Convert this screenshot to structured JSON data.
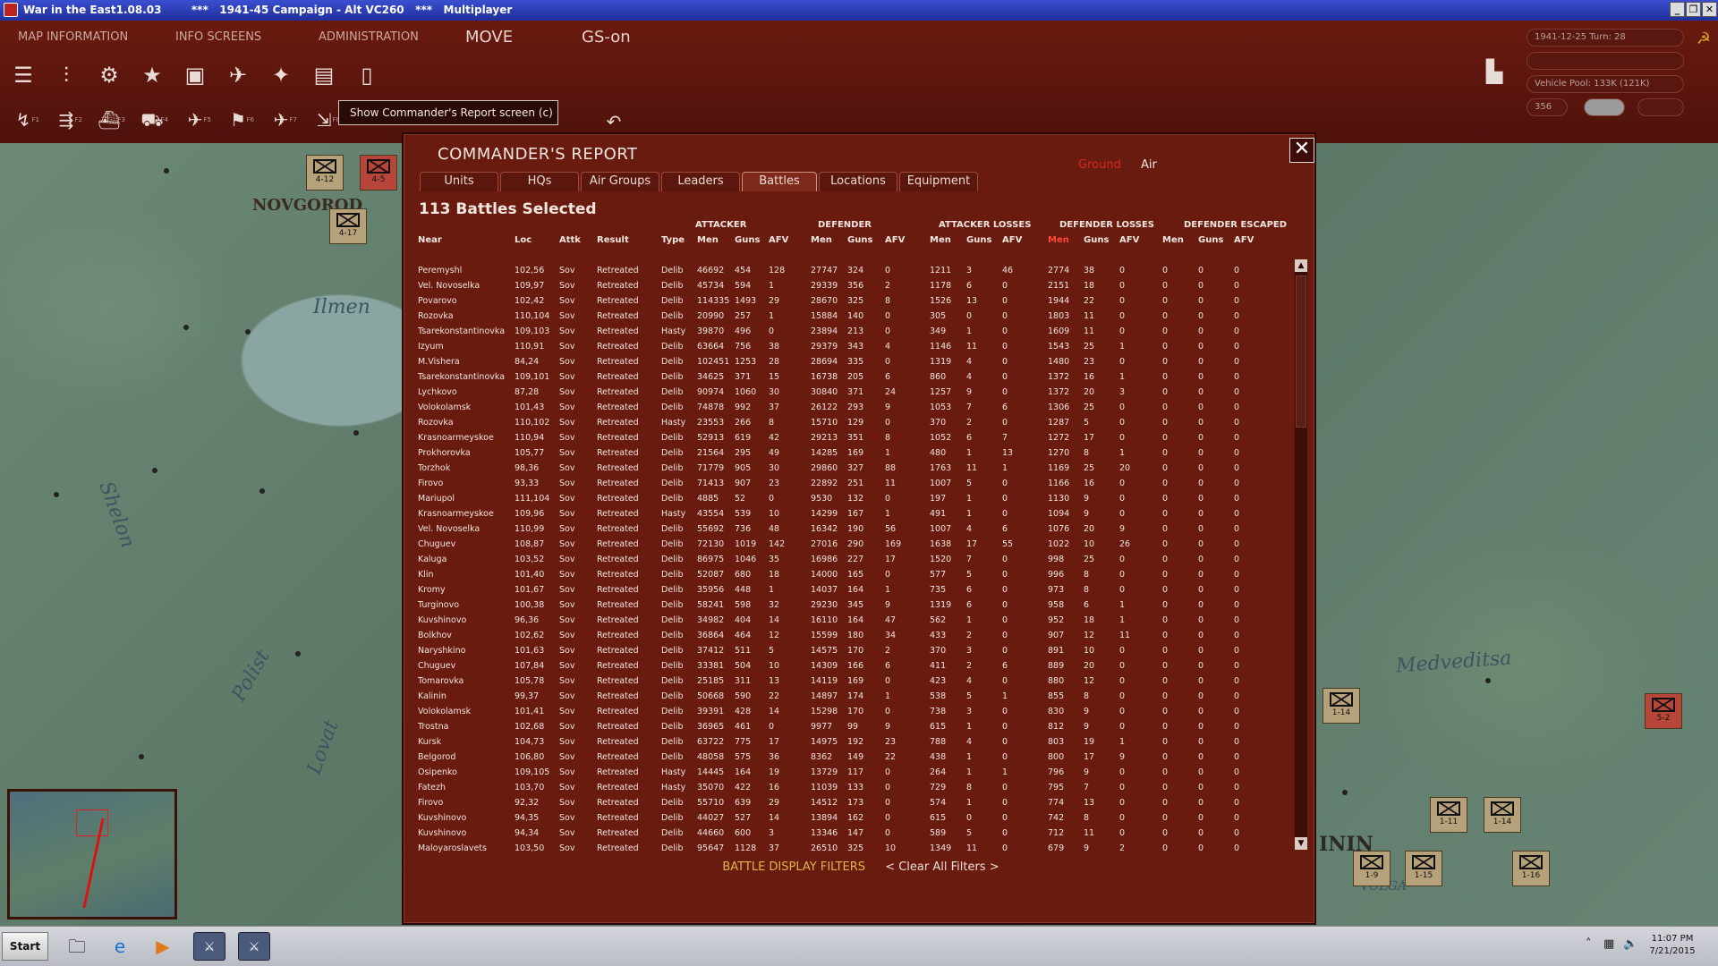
{
  "window": {
    "title": "War in the East1.08.03        ***   1941-45 Campaign - Alt VC260   ***   Multiplayer",
    "buttons": [
      "_",
      "❐",
      "✕"
    ]
  },
  "menu": {
    "map_information": "MAP INFORMATION",
    "info_screens": "INFO SCREENS",
    "administration": "ADMINISTRATION",
    "move": "MOVE",
    "gs": "GS-on"
  },
  "status": {
    "date_turn": "1941-12-25      Turn: 28",
    "vehicle_pool": "Vehicle Pool: 133K (121K)",
    "value": "356"
  },
  "tooltip": "Show Commander's Report screen (c)",
  "map": {
    "labels": {
      "ilmen": "Ilmen",
      "novgorod": "NOVGOROD",
      "medveditsa": "Medveditsa",
      "shelon": "Shelon",
      "polist": "Polist",
      "lovat": "Lovat",
      "kalinin": "ININ",
      "volga": "VOLGA"
    },
    "units": [
      "4-12",
      "4-5",
      "4-17",
      "1-14",
      "5-2",
      "1-11",
      "1-14",
      "1-9",
      "1-15",
      "1-16"
    ]
  },
  "report": {
    "title": "COMMANDER'S REPORT",
    "close": "✕",
    "tabs": [
      "Units",
      "HQs",
      "Air Groups",
      "Leaders",
      "Battles",
      "Locations",
      "Equipment"
    ],
    "active_tab": "Battles",
    "toggle_ground": "Ground",
    "toggle_air": "Air",
    "count_label": "113 Battles Selected",
    "groups": [
      "ATTACKER",
      "DEFENDER",
      "ATTACKER LOSSES",
      "DEFENDER LOSSES",
      "DEFENDER ESCAPED"
    ],
    "headers": [
      "Near",
      "Loc",
      "Attk",
      "Result",
      "Type",
      "Men",
      "Guns",
      "AFV",
      "Men",
      "Guns",
      "AFV",
      "Men",
      "Guns",
      "AFV",
      "Men",
      "Guns",
      "AFV",
      "Men",
      "Guns",
      "AFV"
    ],
    "filters_label": "BATTLE DISPLAY FILTERS",
    "clear_filters": "< Clear All Filters >",
    "rows": [
      [
        "Peremyshl",
        "102,56",
        "Sov",
        "Retreated",
        "Delib",
        "46692",
        "454",
        "128",
        "27747",
        "324",
        "0",
        "1211",
        "3",
        "46",
        "2774",
        "38",
        "0",
        "0",
        "0",
        "0"
      ],
      [
        "Vel. Novoselka",
        "109,97",
        "Sov",
        "Retreated",
        "Delib",
        "45734",
        "594",
        "1",
        "29339",
        "356",
        "2",
        "1178",
        "6",
        "0",
        "2151",
        "18",
        "0",
        "0",
        "0",
        "0"
      ],
      [
        "Povarovo",
        "102,42",
        "Sov",
        "Retreated",
        "Delib",
        "114335",
        "1493",
        "29",
        "28670",
        "325",
        "8",
        "1526",
        "13",
        "0",
        "1944",
        "22",
        "0",
        "0",
        "0",
        "0"
      ],
      [
        "Rozovka",
        "110,104",
        "Sov",
        "Retreated",
        "Delib",
        "20990",
        "257",
        "1",
        "15884",
        "140",
        "0",
        "305",
        "0",
        "0",
        "1803",
        "11",
        "0",
        "0",
        "0",
        "0"
      ],
      [
        "Tsarekonstantinovka",
        "109,103",
        "Sov",
        "Retreated",
        "Hasty",
        "39870",
        "496",
        "0",
        "23894",
        "213",
        "0",
        "349",
        "1",
        "0",
        "1609",
        "11",
        "0",
        "0",
        "0",
        "0"
      ],
      [
        "Izyum",
        "110,91",
        "Sov",
        "Retreated",
        "Delib",
        "63664",
        "756",
        "38",
        "29379",
        "343",
        "4",
        "1146",
        "11",
        "0",
        "1543",
        "25",
        "1",
        "0",
        "0",
        "0"
      ],
      [
        "M.Vishera",
        "84,24",
        "Sov",
        "Retreated",
        "Delib",
        "102451",
        "1253",
        "28",
        "28694",
        "335",
        "0",
        "1319",
        "4",
        "0",
        "1480",
        "23",
        "0",
        "0",
        "0",
        "0"
      ],
      [
        "Tsarekonstantinovka",
        "109,101",
        "Sov",
        "Retreated",
        "Delib",
        "34625",
        "371",
        "15",
        "16738",
        "205",
        "6",
        "860",
        "4",
        "0",
        "1372",
        "16",
        "1",
        "0",
        "0",
        "0"
      ],
      [
        "Lychkovo",
        "87,28",
        "Sov",
        "Retreated",
        "Delib",
        "90974",
        "1060",
        "30",
        "30840",
        "371",
        "24",
        "1257",
        "9",
        "0",
        "1372",
        "20",
        "3",
        "0",
        "0",
        "0"
      ],
      [
        "Volokolamsk",
        "101,43",
        "Sov",
        "Retreated",
        "Delib",
        "74878",
        "992",
        "37",
        "26122",
        "293",
        "9",
        "1053",
        "7",
        "6",
        "1306",
        "25",
        "0",
        "0",
        "0",
        "0"
      ],
      [
        "Rozovka",
        "110,102",
        "Sov",
        "Retreated",
        "Hasty",
        "23553",
        "266",
        "8",
        "15710",
        "129",
        "0",
        "370",
        "2",
        "0",
        "1287",
        "5",
        "0",
        "0",
        "0",
        "0"
      ],
      [
        "Krasnoarmeyskoe",
        "110,94",
        "Sov",
        "Retreated",
        "Delib",
        "52913",
        "619",
        "42",
        "29213",
        "351",
        "8",
        "1052",
        "6",
        "7",
        "1272",
        "17",
        "0",
        "0",
        "0",
        "0"
      ],
      [
        "Prokhorovka",
        "105,77",
        "Sov",
        "Retreated",
        "Delib",
        "21564",
        "295",
        "49",
        "14285",
        "169",
        "1",
        "480",
        "1",
        "13",
        "1270",
        "8",
        "1",
        "0",
        "0",
        "0"
      ],
      [
        "Torzhok",
        "98,36",
        "Sov",
        "Retreated",
        "Delib",
        "71779",
        "905",
        "30",
        "29860",
        "327",
        "88",
        "1763",
        "11",
        "1",
        "1169",
        "25",
        "20",
        "0",
        "0",
        "0"
      ],
      [
        "Firovo",
        "93,33",
        "Sov",
        "Retreated",
        "Delib",
        "71413",
        "907",
        "23",
        "22892",
        "251",
        "11",
        "1007",
        "5",
        "0",
        "1166",
        "16",
        "0",
        "0",
        "0",
        "0"
      ],
      [
        "Mariupol",
        "111,104",
        "Sov",
        "Retreated",
        "Delib",
        "4885",
        "52",
        "0",
        "9530",
        "132",
        "0",
        "197",
        "1",
        "0",
        "1130",
        "9",
        "0",
        "0",
        "0",
        "0"
      ],
      [
        "Krasnoarmeyskoe",
        "109,96",
        "Sov",
        "Retreated",
        "Hasty",
        "43554",
        "539",
        "10",
        "14299",
        "167",
        "1",
        "491",
        "1",
        "0",
        "1094",
        "9",
        "0",
        "0",
        "0",
        "0"
      ],
      [
        "Vel. Novoselka",
        "110,99",
        "Sov",
        "Retreated",
        "Delib",
        "55692",
        "736",
        "48",
        "16342",
        "190",
        "56",
        "1007",
        "4",
        "6",
        "1076",
        "20",
        "9",
        "0",
        "0",
        "0"
      ],
      [
        "Chuguev",
        "108,87",
        "Sov",
        "Retreated",
        "Delib",
        "72130",
        "1019",
        "142",
        "27016",
        "290",
        "169",
        "1638",
        "17",
        "55",
        "1022",
        "10",
        "26",
        "0",
        "0",
        "0"
      ],
      [
        "Kaluga",
        "103,52",
        "Sov",
        "Retreated",
        "Delib",
        "86975",
        "1046",
        "35",
        "16986",
        "227",
        "17",
        "1520",
        "7",
        "0",
        "998",
        "25",
        "0",
        "0",
        "0",
        "0"
      ],
      [
        "Klin",
        "101,40",
        "Sov",
        "Retreated",
        "Delib",
        "52087",
        "680",
        "18",
        "14000",
        "165",
        "0",
        "577",
        "5",
        "0",
        "996",
        "8",
        "0",
        "0",
        "0",
        "0"
      ],
      [
        "Kromy",
        "101,67",
        "Sov",
        "Retreated",
        "Delib",
        "35956",
        "448",
        "1",
        "14037",
        "164",
        "1",
        "735",
        "6",
        "0",
        "973",
        "8",
        "0",
        "0",
        "0",
        "0"
      ],
      [
        "Turginovo",
        "100,38",
        "Sov",
        "Retreated",
        "Delib",
        "58241",
        "598",
        "32",
        "29230",
        "345",
        "9",
        "1319",
        "6",
        "0",
        "958",
        "6",
        "1",
        "0",
        "0",
        "0"
      ],
      [
        "Kuvshinovo",
        "96,36",
        "Sov",
        "Retreated",
        "Delib",
        "34982",
        "404",
        "14",
        "16110",
        "164",
        "47",
        "562",
        "1",
        "0",
        "952",
        "18",
        "1",
        "0",
        "0",
        "0"
      ],
      [
        "Bolkhov",
        "102,62",
        "Sov",
        "Retreated",
        "Delib",
        "36864",
        "464",
        "12",
        "15599",
        "180",
        "34",
        "433",
        "2",
        "0",
        "907",
        "12",
        "11",
        "0",
        "0",
        "0"
      ],
      [
        "Naryshkino",
        "101,63",
        "Sov",
        "Retreated",
        "Delib",
        "37412",
        "511",
        "5",
        "14575",
        "170",
        "2",
        "370",
        "3",
        "0",
        "891",
        "10",
        "0",
        "0",
        "0",
        "0"
      ],
      [
        "Chuguev",
        "107,84",
        "Sov",
        "Retreated",
        "Delib",
        "33381",
        "504",
        "10",
        "14309",
        "166",
        "6",
        "411",
        "2",
        "6",
        "889",
        "20",
        "0",
        "0",
        "0",
        "0"
      ],
      [
        "Tomarovka",
        "105,78",
        "Sov",
        "Retreated",
        "Delib",
        "25185",
        "311",
        "13",
        "14119",
        "169",
        "0",
        "423",
        "4",
        "0",
        "880",
        "12",
        "0",
        "0",
        "0",
        "0"
      ],
      [
        "Kalinin",
        "99,37",
        "Sov",
        "Retreated",
        "Delib",
        "50668",
        "590",
        "22",
        "14897",
        "174",
        "1",
        "538",
        "5",
        "1",
        "855",
        "8",
        "0",
        "0",
        "0",
        "0"
      ],
      [
        "Volokolamsk",
        "101,41",
        "Sov",
        "Retreated",
        "Delib",
        "39391",
        "428",
        "14",
        "15298",
        "170",
        "0",
        "738",
        "3",
        "0",
        "830",
        "9",
        "0",
        "0",
        "0",
        "0"
      ],
      [
        "Trostna",
        "102,68",
        "Sov",
        "Retreated",
        "Delib",
        "36965",
        "461",
        "0",
        "9977",
        "99",
        "9",
        "615",
        "1",
        "0",
        "812",
        "9",
        "0",
        "0",
        "0",
        "0"
      ],
      [
        "Kursk",
        "104,73",
        "Sov",
        "Retreated",
        "Delib",
        "63722",
        "775",
        "17",
        "14975",
        "192",
        "23",
        "788",
        "4",
        "0",
        "803",
        "19",
        "1",
        "0",
        "0",
        "0"
      ],
      [
        "Belgorod",
        "106,80",
        "Sov",
        "Retreated",
        "Delib",
        "48058",
        "575",
        "36",
        "8362",
        "149",
        "22",
        "438",
        "1",
        "0",
        "800",
        "17",
        "9",
        "0",
        "0",
        "0"
      ],
      [
        "Osipenko",
        "109,105",
        "Sov",
        "Retreated",
        "Hasty",
        "14445",
        "164",
        "19",
        "13729",
        "117",
        "0",
        "264",
        "1",
        "1",
        "796",
        "9",
        "0",
        "0",
        "0",
        "0"
      ],
      [
        "Fatezh",
        "103,70",
        "Sov",
        "Retreated",
        "Hasty",
        "35070",
        "422",
        "16",
        "11039",
        "133",
        "0",
        "729",
        "8",
        "0",
        "795",
        "7",
        "0",
        "0",
        "0",
        "0"
      ],
      [
        "Firovo",
        "92,32",
        "Sov",
        "Retreated",
        "Delib",
        "55710",
        "639",
        "29",
        "14512",
        "173",
        "0",
        "574",
        "1",
        "0",
        "774",
        "13",
        "0",
        "0",
        "0",
        "0"
      ],
      [
        "Kuvshinovo",
        "94,35",
        "Sov",
        "Retreated",
        "Delib",
        "44027",
        "527",
        "14",
        "13894",
        "162",
        "0",
        "615",
        "0",
        "0",
        "742",
        "8",
        "0",
        "0",
        "0",
        "0"
      ],
      [
        "Kuvshinovo",
        "94,34",
        "Sov",
        "Retreated",
        "Delib",
        "44660",
        "600",
        "3",
        "13346",
        "147",
        "0",
        "589",
        "5",
        "0",
        "712",
        "11",
        "0",
        "0",
        "0",
        "0"
      ],
      [
        "Maloyaroslavets",
        "103,50",
        "Sov",
        "Retreated",
        "Delib",
        "95647",
        "1128",
        "37",
        "26510",
        "325",
        "10",
        "1349",
        "11",
        "0",
        "679",
        "9",
        "2",
        "0",
        "0",
        "0"
      ]
    ]
  },
  "taskbar": {
    "start": "Start",
    "time": "11:07 PM",
    "date": "7/21/2015"
  },
  "colors": {
    "panel": "#6a1b10",
    "accent": "#e0b54a",
    "highlight": "#ff4a3a"
  }
}
